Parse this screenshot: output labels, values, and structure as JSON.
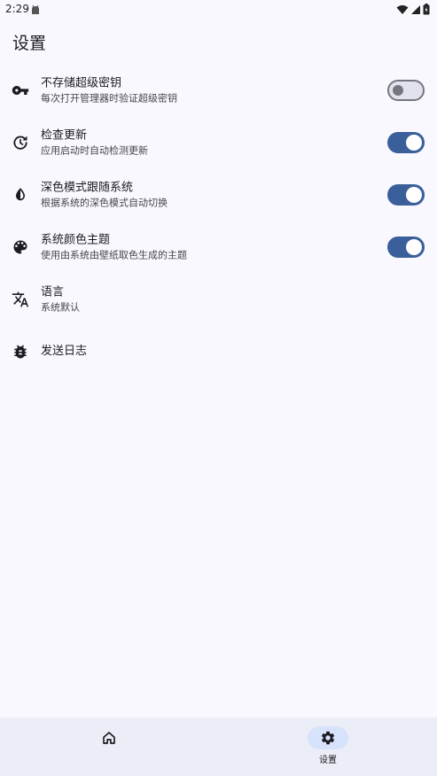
{
  "status_bar": {
    "time": "2:29"
  },
  "page": {
    "title": "设置"
  },
  "settings": [
    {
      "title": "不存储超级密钥",
      "subtitle": "每次打开管理器时验证超级密钥",
      "icon": "key-icon",
      "toggle": false
    },
    {
      "title": "检查更新",
      "subtitle": "应用启动时自动检测更新",
      "icon": "update-icon",
      "toggle": true
    },
    {
      "title": "深色模式跟随系统",
      "subtitle": "根据系统的深色模式自动切换",
      "icon": "contrast-icon",
      "toggle": true
    },
    {
      "title": "系统颜色主题",
      "subtitle": "使用由系统由壁纸取色生成的主题",
      "icon": "palette-icon",
      "toggle": true
    },
    {
      "title": "语言",
      "subtitle": "系统默认",
      "icon": "translate-icon"
    },
    {
      "title": "发送日志",
      "icon": "bug-icon"
    }
  ],
  "bottom_nav": {
    "items": [
      {
        "label": "",
        "icon": "home-icon",
        "active": false
      },
      {
        "label": "设置",
        "icon": "gear-icon",
        "active": true
      }
    ]
  },
  "colors": {
    "accent": "#3a5f9a",
    "background": "#f9f8fe",
    "nav_background": "#eceef7",
    "indicator": "#d7e2fb"
  }
}
